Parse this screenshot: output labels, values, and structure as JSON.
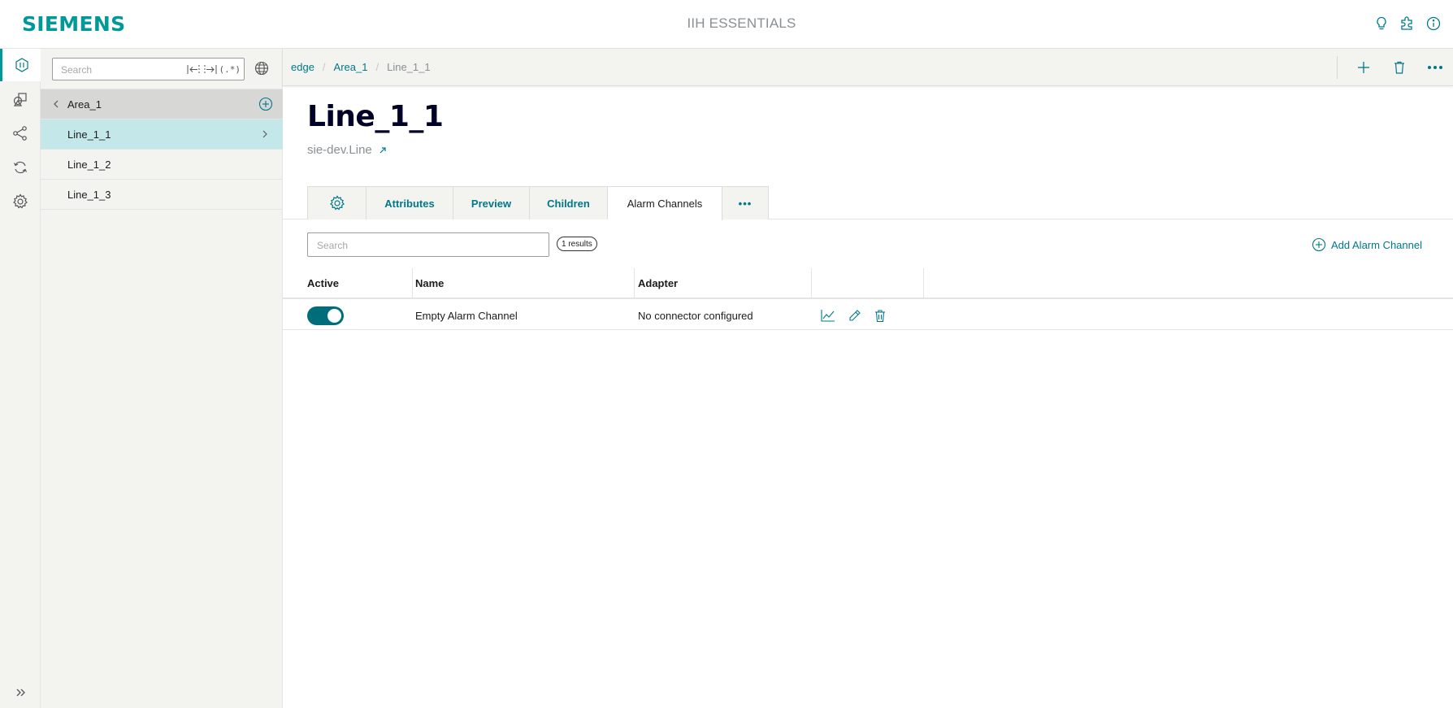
{
  "header": {
    "logo": "SIEMENS",
    "app_title": "IIH ESSENTIALS",
    "icons": [
      "lightbulb-icon",
      "puzzle-icon",
      "info-icon"
    ]
  },
  "rail": {
    "items": [
      "asset-model-icon",
      "shapes-icon",
      "connections-icon",
      "sync-icon",
      "settings-icon"
    ],
    "expand_icon": "double-chevron-right-icon"
  },
  "tree": {
    "search_placeholder": "Search",
    "search_buttons": [
      "collapse-left-icon",
      "expand-right-icon",
      "(.*)"
    ],
    "parent": "Area_1",
    "items": [
      {
        "label": "Line_1_1",
        "selected": true
      },
      {
        "label": "Line_1_2",
        "selected": false
      },
      {
        "label": "Line_1_3",
        "selected": false
      }
    ]
  },
  "breadcrumb": [
    "edge",
    "Area_1",
    "Line_1_1"
  ],
  "asset": {
    "title": "Line_1_1",
    "type": "sie-dev.Line"
  },
  "tabs": [
    {
      "label": "",
      "icon": "gear-icon",
      "active": false
    },
    {
      "label": "Attributes",
      "active": false
    },
    {
      "label": "Preview",
      "active": false
    },
    {
      "label": "Children",
      "active": false
    },
    {
      "label": "Alarm Channels",
      "active": true
    },
    {
      "label": "•••",
      "active": false
    }
  ],
  "alarm_channels": {
    "search_placeholder": "Search",
    "results_badge": "1 results",
    "add_button": "Add Alarm Channel",
    "columns": [
      "Active",
      "Name",
      "Adapter"
    ],
    "rows": [
      {
        "active": true,
        "name": "Empty Alarm Channel",
        "adapter": "No connector configured",
        "actions": [
          "chart-icon",
          "pencil-icon",
          "trash-icon"
        ]
      }
    ]
  },
  "colors": {
    "brand": "#009999",
    "link": "#00788a",
    "toggle_on": "#006e7a",
    "selected_row": "#c4e8ea"
  }
}
